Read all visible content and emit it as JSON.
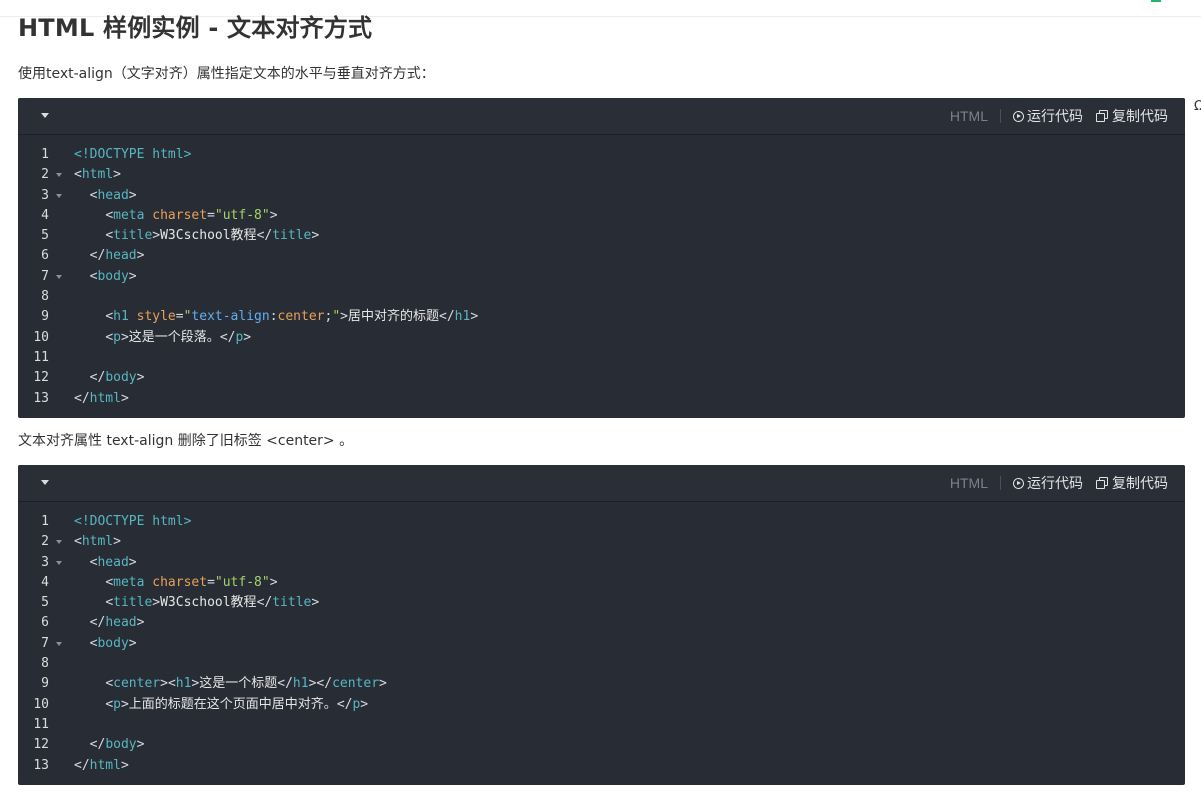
{
  "page": {
    "title": "HTML 样例实例 - 文本对齐方式",
    "intro": "使用text-align（文字对齐）属性指定文本的水平与垂直对齐方式：",
    "note": "文本对齐属性 text-align 删除了旧标签 <center> 。",
    "edge_glyph": "Ω"
  },
  "toolbar": {
    "lang": "HTML",
    "run_label": "运行代码",
    "copy_label": "复制代码"
  },
  "examples": [
    {
      "lines": [
        {
          "n": "1",
          "fold": false,
          "indent": 0,
          "tokens": [
            [
              "doc",
              "<!DOCTYPE html>"
            ]
          ]
        },
        {
          "n": "2",
          "fold": true,
          "indent": 0,
          "tokens": [
            [
              "br",
              "<"
            ],
            [
              "tag",
              "html"
            ],
            [
              "br",
              ">"
            ]
          ]
        },
        {
          "n": "3",
          "fold": true,
          "indent": 2,
          "tokens": [
            [
              "br",
              "<"
            ],
            [
              "tag",
              "head"
            ],
            [
              "br",
              ">"
            ]
          ]
        },
        {
          "n": "4",
          "fold": false,
          "indent": 4,
          "tokens": [
            [
              "br",
              "<"
            ],
            [
              "tag",
              "meta"
            ],
            [
              "txt",
              " "
            ],
            [
              "attr",
              "charset"
            ],
            [
              "br",
              "="
            ],
            [
              "str",
              "\"utf-8\""
            ],
            [
              "br",
              ">"
            ]
          ]
        },
        {
          "n": "5",
          "fold": false,
          "indent": 4,
          "tokens": [
            [
              "br",
              "<"
            ],
            [
              "tag",
              "title"
            ],
            [
              "br",
              ">"
            ],
            [
              "txt",
              "W3Cschool教程"
            ],
            [
              "br",
              "</"
            ],
            [
              "tag",
              "title"
            ],
            [
              "br",
              ">"
            ]
          ]
        },
        {
          "n": "6",
          "fold": false,
          "indent": 2,
          "tokens": [
            [
              "br",
              "</"
            ],
            [
              "tag",
              "head"
            ],
            [
              "br",
              ">"
            ]
          ]
        },
        {
          "n": "7",
          "fold": true,
          "indent": 2,
          "tokens": [
            [
              "br",
              "<"
            ],
            [
              "tag",
              "body"
            ],
            [
              "br",
              ">"
            ]
          ]
        },
        {
          "n": "8",
          "fold": false,
          "indent": 0,
          "tokens": []
        },
        {
          "n": "9",
          "fold": false,
          "indent": 4,
          "tokens": [
            [
              "br",
              "<"
            ],
            [
              "tag",
              "h1"
            ],
            [
              "txt",
              " "
            ],
            [
              "attr",
              "style"
            ],
            [
              "br",
              "="
            ],
            [
              "str",
              "\""
            ],
            [
              "prop",
              "text-align"
            ],
            [
              "br",
              ":"
            ],
            [
              "attr",
              "center"
            ],
            [
              "br",
              ";"
            ],
            [
              "str",
              "\""
            ],
            [
              "br",
              ">"
            ],
            [
              "txt",
              "居中对齐的标题"
            ],
            [
              "br",
              "</"
            ],
            [
              "tag",
              "h1"
            ],
            [
              "br",
              ">"
            ]
          ]
        },
        {
          "n": "10",
          "fold": false,
          "indent": 4,
          "tokens": [
            [
              "br",
              "<"
            ],
            [
              "tag",
              "p"
            ],
            [
              "br",
              ">"
            ],
            [
              "txt",
              "这是一个段落。"
            ],
            [
              "br",
              "</"
            ],
            [
              "tag",
              "p"
            ],
            [
              "br",
              ">"
            ]
          ]
        },
        {
          "n": "11",
          "fold": false,
          "indent": 0,
          "tokens": []
        },
        {
          "n": "12",
          "fold": false,
          "indent": 2,
          "tokens": [
            [
              "br",
              "</"
            ],
            [
              "tag",
              "body"
            ],
            [
              "br",
              ">"
            ]
          ]
        },
        {
          "n": "13",
          "fold": false,
          "indent": 0,
          "tokens": [
            [
              "br",
              "</"
            ],
            [
              "tag",
              "html"
            ],
            [
              "br",
              ">"
            ]
          ]
        }
      ]
    },
    {
      "lines": [
        {
          "n": "1",
          "fold": false,
          "indent": 0,
          "tokens": [
            [
              "doc",
              "<!DOCTYPE html>"
            ]
          ]
        },
        {
          "n": "2",
          "fold": true,
          "indent": 0,
          "tokens": [
            [
              "br",
              "<"
            ],
            [
              "tag",
              "html"
            ],
            [
              "br",
              ">"
            ]
          ]
        },
        {
          "n": "3",
          "fold": true,
          "indent": 2,
          "tokens": [
            [
              "br",
              "<"
            ],
            [
              "tag",
              "head"
            ],
            [
              "br",
              ">"
            ]
          ]
        },
        {
          "n": "4",
          "fold": false,
          "indent": 4,
          "tokens": [
            [
              "br",
              "<"
            ],
            [
              "tag",
              "meta"
            ],
            [
              "txt",
              " "
            ],
            [
              "attr",
              "charset"
            ],
            [
              "br",
              "="
            ],
            [
              "str",
              "\"utf-8\""
            ],
            [
              "br",
              ">"
            ]
          ]
        },
        {
          "n": "5",
          "fold": false,
          "indent": 4,
          "tokens": [
            [
              "br",
              "<"
            ],
            [
              "tag",
              "title"
            ],
            [
              "br",
              ">"
            ],
            [
              "txt",
              "W3Cschool教程"
            ],
            [
              "br",
              "</"
            ],
            [
              "tag",
              "title"
            ],
            [
              "br",
              ">"
            ]
          ]
        },
        {
          "n": "6",
          "fold": false,
          "indent": 2,
          "tokens": [
            [
              "br",
              "</"
            ],
            [
              "tag",
              "head"
            ],
            [
              "br",
              ">"
            ]
          ]
        },
        {
          "n": "7",
          "fold": true,
          "indent": 2,
          "tokens": [
            [
              "br",
              "<"
            ],
            [
              "tag",
              "body"
            ],
            [
              "br",
              ">"
            ]
          ]
        },
        {
          "n": "8",
          "fold": false,
          "indent": 0,
          "tokens": []
        },
        {
          "n": "9",
          "fold": false,
          "indent": 4,
          "tokens": [
            [
              "br",
              "<"
            ],
            [
              "tag",
              "center"
            ],
            [
              "br",
              ">"
            ],
            [
              "br",
              "<"
            ],
            [
              "tag",
              "h1"
            ],
            [
              "br",
              ">"
            ],
            [
              "txt",
              "这是一个标题"
            ],
            [
              "br",
              "</"
            ],
            [
              "tag",
              "h1"
            ],
            [
              "br",
              ">"
            ],
            [
              "br",
              "</"
            ],
            [
              "tag",
              "center"
            ],
            [
              "br",
              ">"
            ]
          ]
        },
        {
          "n": "10",
          "fold": false,
          "indent": 4,
          "tokens": [
            [
              "br",
              "<"
            ],
            [
              "tag",
              "p"
            ],
            [
              "br",
              ">"
            ],
            [
              "txt",
              "上面的标题在这个页面中居中对齐。"
            ],
            [
              "br",
              "</"
            ],
            [
              "tag",
              "p"
            ],
            [
              "br",
              ">"
            ]
          ]
        },
        {
          "n": "11",
          "fold": false,
          "indent": 0,
          "tokens": []
        },
        {
          "n": "12",
          "fold": false,
          "indent": 2,
          "tokens": [
            [
              "br",
              "</"
            ],
            [
              "tag",
              "body"
            ],
            [
              "br",
              ">"
            ]
          ]
        },
        {
          "n": "13",
          "fold": false,
          "indent": 0,
          "tokens": [
            [
              "br",
              "</"
            ],
            [
              "tag",
              "html"
            ],
            [
              "br",
              ">"
            ]
          ]
        }
      ]
    }
  ],
  "icons": {
    "collapse": "chevron-down-icon",
    "run": "play-circle-icon",
    "copy": "copy-icon",
    "fold": "fold-caret-icon"
  },
  "colors": {
    "code_bg": "#282c34",
    "tag": "#56b6c2",
    "attr": "#e6a15a",
    "string": "#a6d36a",
    "property": "#61afef",
    "accent": "#26b36f"
  }
}
